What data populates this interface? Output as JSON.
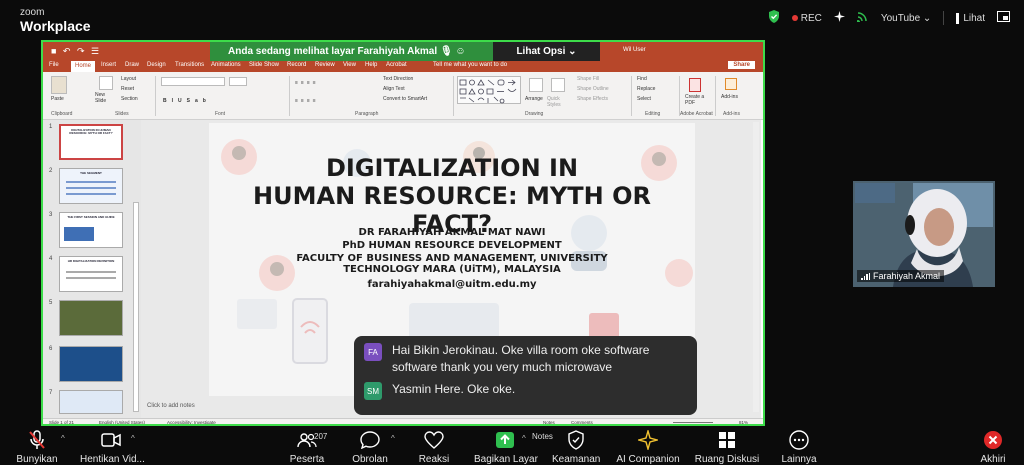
{
  "app": {
    "brand_top": "zoom",
    "brand_bottom": "Workplace"
  },
  "topbar": {
    "rec": "REC",
    "youtube": "YouTube",
    "view": "Lihat"
  },
  "banner": {
    "text": "Anda sedang melihat layar  Farahiyah Akmal",
    "options": "Lihat Opsi"
  },
  "ppt": {
    "quick_access": "■ ↶ ↷ ☰",
    "user": "Wil User",
    "share": "Share",
    "tabs": [
      "File",
      "Home",
      "Insert",
      "Draw",
      "Design",
      "Transitions",
      "Animations",
      "Slide Show",
      "Record",
      "Review",
      "View",
      "Help",
      "Acrobat",
      "Tell me what you want to do"
    ],
    "ribbon_groups": [
      "Clipboard",
      "Slides",
      "Font",
      "Paragraph",
      "Drawing",
      "Editing",
      "Adobe Acrobat",
      "Add-ins"
    ],
    "ribbon": {
      "paste": "Paste",
      "new_slide": "New Slide",
      "layout": "Layout",
      "reset": "Reset",
      "section": "Section",
      "text_direction": "Text Direction",
      "align_text": "Align Text",
      "convert_smartart": "Convert to SmartArt",
      "arrange": "Arrange",
      "quick_styles": "Quick Styles",
      "shape_fill": "Shape Fill",
      "shape_outline": "Shape Outline",
      "shape_effects": "Shape Effects",
      "find": "Find",
      "replace": "Replace",
      "select": "Select",
      "create_pdf": "Create a PDF",
      "addins": "Add-ins"
    },
    "slide_numbers": [
      "1",
      "2",
      "3",
      "4",
      "5",
      "6",
      "7"
    ],
    "thumb_titles": [
      "DIGITALIZATION IN HUMAN RESOURCE: MYTH OR FACT?",
      "THE SEGMENT",
      "THE FIRST SESSION AND GUIDE",
      "HR DIGITALIZATION DEFINITION",
      "",
      "",
      ""
    ],
    "notes": "Click to add notes",
    "status": {
      "slide": "Slide 1 of 21",
      "lang": "English (United States)",
      "access": "Accessibility: Investigate",
      "notes_btn": "Notes",
      "comments_btn": "Comments",
      "zoom": "81%"
    }
  },
  "slide": {
    "title_line1": "DIGITALIZATION IN",
    "title_line2": "HUMAN RESOURCE: MYTH OR FACT?",
    "lines": [
      "DR FARAHIYAH AKMAL MAT NAWI",
      "PhD HUMAN RESOURCE DEVELOPMENT",
      "FACULTY OF BUSINESS AND MANAGEMENT, UNIVERSITY",
      "TECHNOLOGY MARA (UiTM), MALAYSIA",
      "farahiyahakmal@uitm.edu.my"
    ]
  },
  "video": {
    "name": "Farahiyah Akmal"
  },
  "chat": {
    "messages": [
      {
        "initials": "FA",
        "color": "#7a4fbf",
        "text": "Hai Bikin Jerokinau. Oke villa room oke software software thank you very much microwave"
      },
      {
        "initials": "SM",
        "color": "#2e9a6b",
        "text": "Yasmin Here. Oke oke."
      }
    ]
  },
  "toolbar": {
    "mute": "Bunyikan",
    "video": "Hentikan Vid...",
    "participants": "Peserta",
    "participants_count": "207",
    "chat": "Obrolan",
    "reactions": "Reaksi",
    "share": "Bagikan Layar",
    "notes": "Notes",
    "security": "Keamanan",
    "ai": "AI Companion",
    "rooms": "Ruang Diskusi",
    "more": "Lainnya",
    "end": "Akhiri"
  }
}
